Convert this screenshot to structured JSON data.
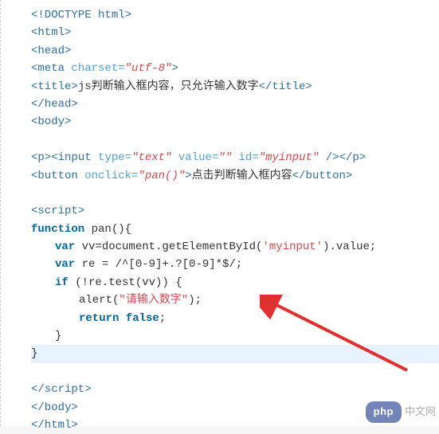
{
  "code": {
    "l1": "<!DOCTYPE html>",
    "l2": "<html>",
    "l3": "<head>",
    "l4_open": "<meta",
    "l4_attr": " charset=",
    "l4_val": "\"utf-8\"",
    "l4_close": ">",
    "l5_open": "<title>",
    "l5_text": "js判断输入框内容，只允许输入数字",
    "l5_close": "</title>",
    "l6": "</head>",
    "l7": "<body>",
    "l8_popen": "<p>",
    "l8_iopen": "<input",
    "l8_typeattr": " type=",
    "l8_typeval": "\"text\"",
    "l8_valattr": " value=",
    "l8_valval": "\"\"",
    "l8_idattr": " id=",
    "l8_idval": "\"myinput\"",
    "l8_iclose": " />",
    "l8_pclose": "</p>",
    "l9_bopen": "<button",
    "l9_onclickattr": " onclick=",
    "l9_onclickval": "\"pan()\"",
    "l9_gt": ">",
    "l9_text": "点击判断输入框内容",
    "l9_bclose": "</button>",
    "l10": "<script>",
    "l11_func": "function",
    "l11_name": " pan",
    "l11_paren": "(){",
    "l12_var": "var",
    "l12_rest": " vv=document.getElementById(",
    "l12_arg": "'myinput'",
    "l12_end": ").value;",
    "l13_var": "var",
    "l13_rest": " re = /^[0-9]+.?[0-9]*$/;",
    "l14_if": "if",
    "l14_rest": " (!re.test(vv)) {",
    "l15_alert": "alert(",
    "l15_str": "\"请输入数字\"",
    "l15_end": ");",
    "l16_return": "return",
    "l16_false": " false",
    "l16_semi": ";",
    "l17": "}",
    "l18": "}",
    "l19": "</script>",
    "l20": "</body>",
    "l21": "</html>"
  },
  "watermark": {
    "php": "php",
    "cn": "中文网"
  }
}
